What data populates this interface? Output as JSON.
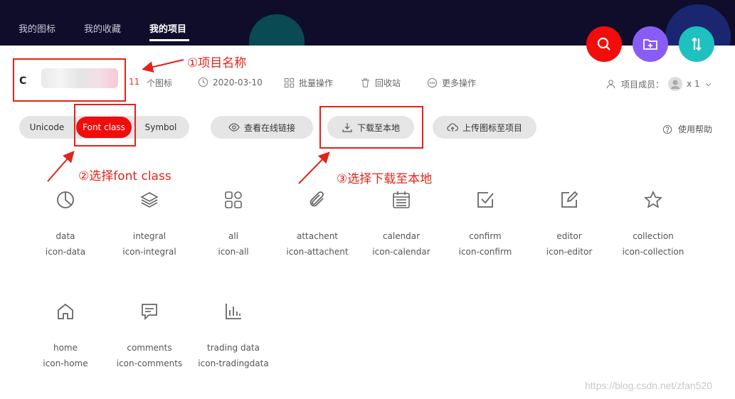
{
  "nav": {
    "tabs": [
      "我的图标",
      "我的收藏",
      "我的项目"
    ],
    "active_index": 2
  },
  "project": {
    "name_prefix": "C",
    "icon_count": "11",
    "icon_count_label": "个图标",
    "date": "2020-03-10",
    "batch_label": "批量操作",
    "recycle_label": "回收站",
    "more_label": "更多操作",
    "members_label": "项目成员：",
    "members_count": "x 1"
  },
  "format_tabs": [
    "Unicode",
    "Font class",
    "Symbol"
  ],
  "format_active": "Font class",
  "actions": {
    "view_link": "查看在线链接",
    "download": "下载至本地",
    "upload": "上传图标至项目",
    "help": "使用帮助"
  },
  "annotations": {
    "step1": "①项目名称",
    "step2": "②选择font class",
    "step3": "③选择下载至本地"
  },
  "icons": [
    {
      "name": "data",
      "class": "icon-data",
      "glyph": "pie-chart-icon"
    },
    {
      "name": "integral",
      "class": "icon-integral",
      "glyph": "layers-icon"
    },
    {
      "name": "all",
      "class": "icon-all",
      "glyph": "grid-icon"
    },
    {
      "name": "attachent",
      "class": "icon-attachent",
      "glyph": "paperclip-icon"
    },
    {
      "name": "calendar",
      "class": "icon-calendar",
      "glyph": "calendar-icon"
    },
    {
      "name": "confirm",
      "class": "icon-confirm",
      "glyph": "checkbox-icon"
    },
    {
      "name": "editor",
      "class": "icon-editor",
      "glyph": "edit-icon"
    },
    {
      "name": "collection",
      "class": "icon-collection",
      "glyph": "star-icon"
    },
    {
      "name": "home",
      "class": "icon-home",
      "glyph": "home-icon"
    },
    {
      "name": "comments",
      "class": "icon-comments",
      "glyph": "comment-icon"
    },
    {
      "name": "trading data",
      "class": "icon-tradingdata",
      "glyph": "bar-chart-icon"
    }
  ],
  "colors": {
    "accent": "#f20d0d",
    "nav_bg": "#0f0d2a",
    "fab_search": "#f20d0d",
    "fab_add": "#8a5cf6",
    "fab_sort": "#1fc0c0",
    "annotation": "#e2231a"
  },
  "watermark": "https://blog.csdn.net/zfan520"
}
